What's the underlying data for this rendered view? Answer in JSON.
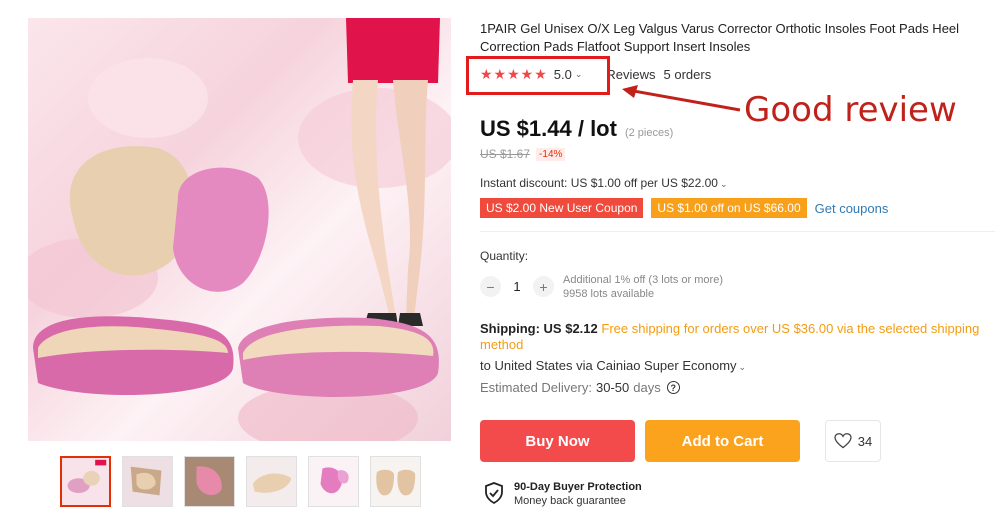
{
  "product": {
    "title": "1PAIR Gel Unisex O/X Leg Valgus Varus Corrector Orthotic Insoles Foot Pads Heel Correction Pads Flatfoot Support Insert Insoles",
    "rating": {
      "stars": "★★★★★",
      "value": "5.0",
      "chevron": "⌄",
      "reviews_label": "Reviews",
      "orders_label": "5 orders"
    },
    "price": {
      "current": "US $1.44 / lot",
      "pieces": "(2 pieces)",
      "original": "US $1.67",
      "discount": "-14%"
    },
    "instant_discount": "Instant discount: US $1.00 off per US $22.00",
    "coupons": {
      "new_user": "US $2.00 New User Coupon",
      "off": "US $1.00 off on US $66.00",
      "get_label": "Get coupons"
    },
    "quantity": {
      "label": "Quantity:",
      "minus": "−",
      "value": "1",
      "plus": "+",
      "additional": "Additional 1% off (3 lots or more)",
      "available": "9958 lots available"
    },
    "shipping": {
      "label": "Shipping: US $2.12",
      "free": "Free shipping for orders over US $36.00 via the selected shipping method",
      "to": "to United States via Cainiao Super Economy",
      "delivery_label": "Estimated Delivery:",
      "delivery_days": "30-50",
      "delivery_unit": "days",
      "help": "?"
    },
    "actions": {
      "buy_now": "Buy Now",
      "add_to_cart": "Add to Cart",
      "wishlist_count": "34"
    },
    "protection": {
      "title": "90-Day Buyer Protection",
      "subtitle": "Money back guarantee"
    }
  },
  "annotation": {
    "text": "Good review",
    "color": "#c0211b"
  },
  "colors": {
    "buy": "#f34b4b",
    "cart": "#fba31c",
    "star": "#f04848",
    "link": "#2f7ab5",
    "free_shipping": "#f39c12"
  },
  "gallery": {
    "thumbnail_count": 6,
    "active_index": 0
  }
}
